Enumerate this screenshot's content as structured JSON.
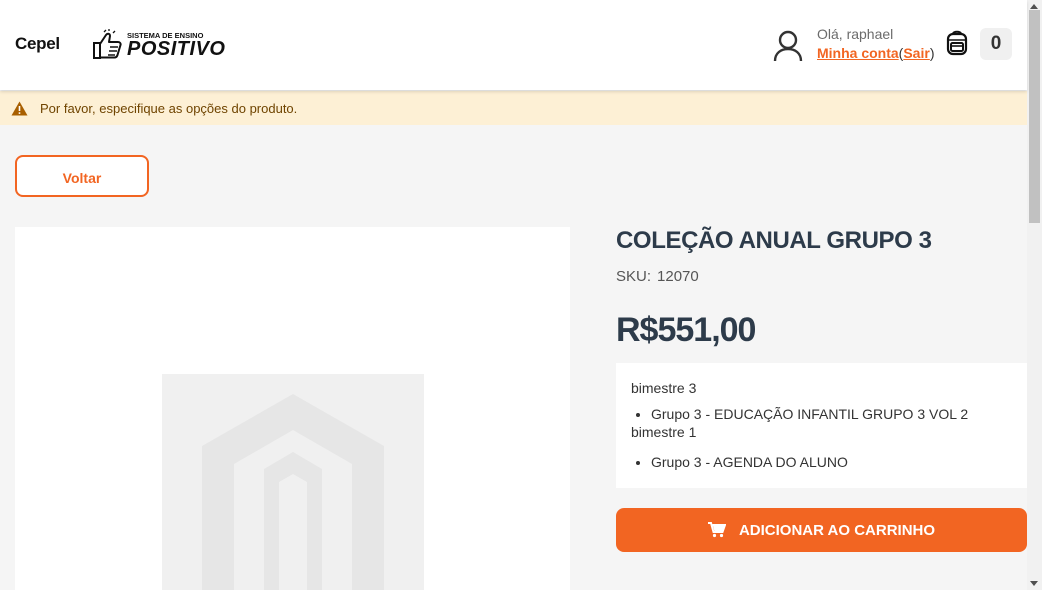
{
  "header": {
    "store_name": "Cepel",
    "logo": {
      "small_text": "SISTEMA DE ENSINO",
      "big_text": "POSITIVO"
    },
    "account": {
      "greeting": "Olá, raphael",
      "my_account_label": "Minha conta",
      "open_paren": "(",
      "logout_label": "Sair",
      "close_paren": ")"
    },
    "cart": {
      "icon": "backpack-icon",
      "count": "0"
    }
  },
  "notice": {
    "icon": "warning-icon",
    "text": "Por favor, especifique as opções do produto."
  },
  "back_button": {
    "label": "Voltar"
  },
  "product": {
    "title": "COLEÇÃO ANUAL GRUPO 3",
    "sku_label": "SKU:",
    "sku_value": "12070",
    "price": "R$551,00",
    "description": {
      "lines": [
        {
          "type": "text",
          "value": "bimestre 3"
        },
        {
          "type": "bullet",
          "value": "Grupo 3 - EDUCAÇÃO INFANTIL GRUPO 3 VOL 2"
        },
        {
          "type": "text",
          "value": "bimestre 1"
        },
        {
          "type": "bullet",
          "value": "Grupo 3 - AGENDA DO ALUNO"
        }
      ]
    },
    "add_to_cart_label": "ADICIONAR AO CARRINHO"
  },
  "colors": {
    "accent": "#f26522",
    "title": "#2d3b4a",
    "notice_bg": "#fdf0d5"
  }
}
